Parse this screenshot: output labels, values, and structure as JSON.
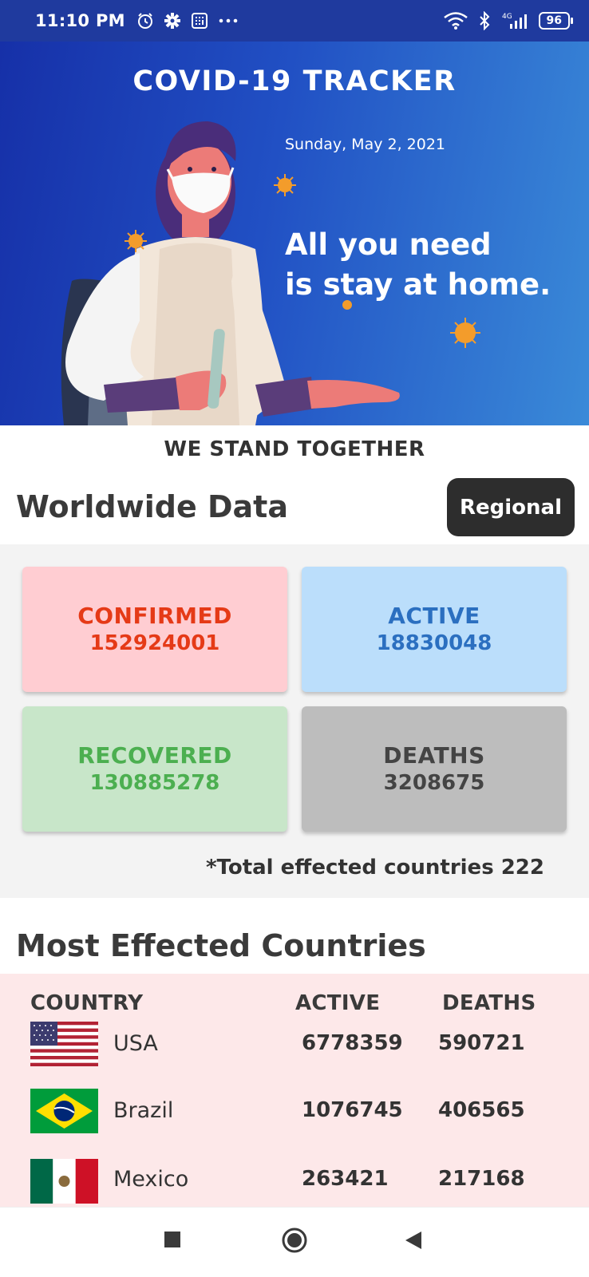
{
  "status_bar": {
    "time": "11:10 PM",
    "battery": "96",
    "network": "4G"
  },
  "header": {
    "title": "COVID-19 TRACKER",
    "date": "Sunday, May 2, 2021",
    "slogan_line1": "All you need",
    "slogan_line2": "is stay at home."
  },
  "tagline": "WE STAND TOGETHER",
  "worldwide": {
    "title": "Worldwide Data",
    "regional_button": "Regional",
    "cards": {
      "confirmed": {
        "label": "CONFIRMED",
        "value": "152924001"
      },
      "active": {
        "label": "ACTIVE",
        "value": "18830048"
      },
      "recovered": {
        "label": "RECOVERED",
        "value": "130885278"
      },
      "deaths": {
        "label": "DEATHS",
        "value": "3208675"
      }
    },
    "total_note": "*Total effected countries 222"
  },
  "countries": {
    "title": "Most Effected Countries",
    "columns": [
      "COUNTRY",
      "ACTIVE",
      "DEATHS"
    ],
    "rows": [
      {
        "country": "USA",
        "active": "6778359",
        "deaths": "590721",
        "flag": "usa-flag"
      },
      {
        "country": "Brazil",
        "active": "1076745",
        "deaths": "406565",
        "flag": "brazil-flag"
      },
      {
        "country": "Mexico",
        "active": "263421",
        "deaths": "217168",
        "flag": "mexico-flag"
      }
    ]
  },
  "colors": {
    "confirmed": "#e53a17",
    "active": "#2b6fc0",
    "recovered": "#4caf50",
    "deaths": "#444444",
    "hero_start": "#1630a8",
    "hero_end": "#3a8ad8"
  }
}
